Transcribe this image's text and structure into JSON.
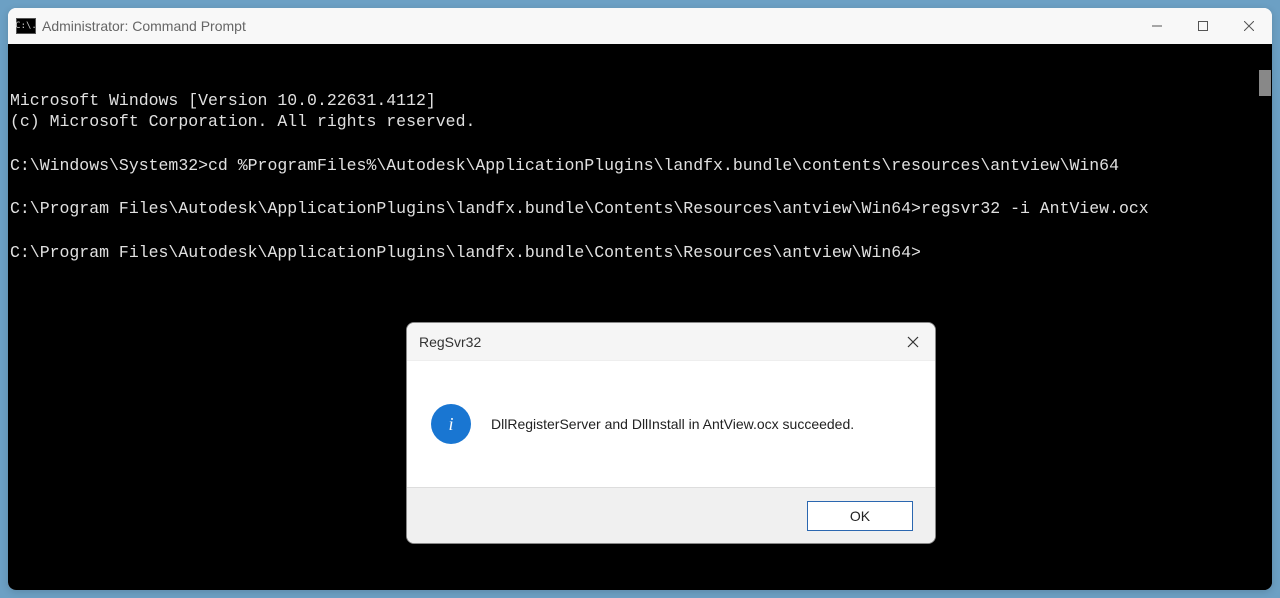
{
  "window": {
    "title": "Administrator: Command Prompt",
    "icon_text": "C:\\."
  },
  "terminal": {
    "lines": [
      "Microsoft Windows [Version 10.0.22631.4112]",
      "(c) Microsoft Corporation. All rights reserved.",
      "",
      "C:\\Windows\\System32>cd %ProgramFiles%\\Autodesk\\ApplicationPlugins\\landfx.bundle\\contents\\resources\\antview\\Win64",
      "",
      "C:\\Program Files\\Autodesk\\ApplicationPlugins\\landfx.bundle\\Contents\\Resources\\antview\\Win64>regsvr32 -i AntView.ocx",
      "",
      "C:\\Program Files\\Autodesk\\ApplicationPlugins\\landfx.bundle\\Contents\\Resources\\antview\\Win64>"
    ]
  },
  "dialog": {
    "title": "RegSvr32",
    "message": "DllRegisterServer and DllInstall in AntView.ocx succeeded.",
    "ok_label": "OK",
    "info_char": "i"
  }
}
